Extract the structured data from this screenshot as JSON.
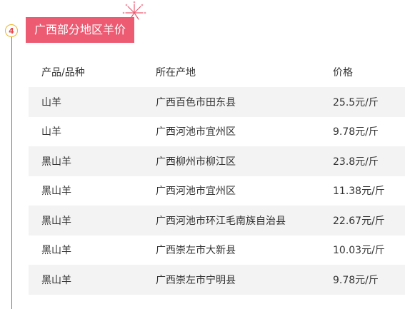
{
  "section": {
    "number": "4",
    "title": "广西部分地区羊价"
  },
  "table": {
    "headers": {
      "product": "产品/品种",
      "location": "所在产地",
      "price": "价格"
    },
    "rows": [
      {
        "product": "山羊",
        "location": "广西百色市田东县",
        "price": "25.5元/斤"
      },
      {
        "product": "山羊",
        "location": "广西河池市宜州区",
        "price": "9.78元/斤"
      },
      {
        "product": "黑山羊",
        "location": "广西柳州市柳江区",
        "price": "23.8元/斤"
      },
      {
        "product": "黑山羊",
        "location": "广西河池市宜州区",
        "price": "11.38元/斤"
      },
      {
        "product": "黑山羊",
        "location": "广西河池市环江毛南族自治县",
        "price": "22.67元/斤"
      },
      {
        "product": "黑山羊",
        "location": "广西崇左市大新县",
        "price": "10.03元/斤"
      },
      {
        "product": "黑山羊",
        "location": "广西崇左市宁明县",
        "price": "9.78元/斤"
      }
    ]
  },
  "colors": {
    "accent": "#ec5b72",
    "timeline": "#e5484d",
    "badge_border": "#f0b429",
    "row_shade": "#f3f3f3"
  }
}
